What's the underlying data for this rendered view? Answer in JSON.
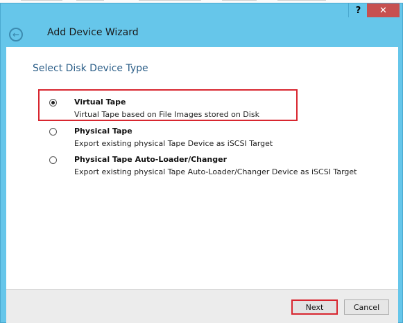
{
  "window": {
    "help_glyph": "?",
    "close_glyph": "✕",
    "back_glyph": "←",
    "title": "Add Device Wizard"
  },
  "section_title": "Select Disk Device Type",
  "options": [
    {
      "title": "Virtual Tape",
      "description": "Virtual Tape based on File Images stored on Disk",
      "selected": true
    },
    {
      "title": "Physical Tape",
      "description": "Export existing physical Tape Device as iSCSI Target",
      "selected": false
    },
    {
      "title": "Physical Tape Auto-Loader/Changer",
      "description": "Export existing physical Tape Auto-Loader/Changer Device as iSCSI Target",
      "selected": false
    }
  ],
  "buttons": {
    "next": "Next",
    "cancel": "Cancel"
  },
  "colors": {
    "frame": "#66c6ea",
    "close": "#c75050",
    "highlight": "#d8262f",
    "section_title": "#2a5d87"
  }
}
